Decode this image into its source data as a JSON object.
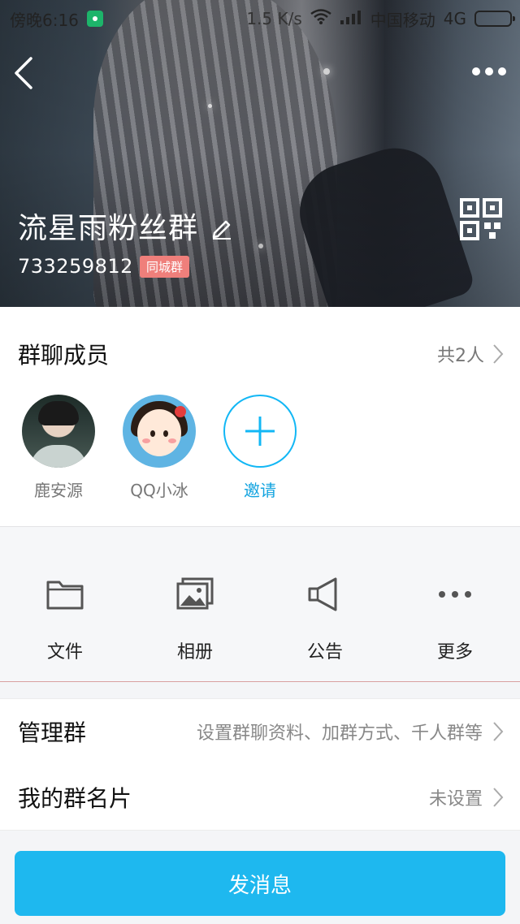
{
  "status_bar": {
    "time": "傍晚6:16",
    "speed": "1.5 K/s",
    "carrier": "中国移动",
    "network": "4G"
  },
  "group": {
    "name": "流星雨粉丝群",
    "id": "733259812",
    "tag": "同城群"
  },
  "members": {
    "title": "群聊成员",
    "count_label": "共2人",
    "list": [
      {
        "name": "鹿安源"
      },
      {
        "name": "QQ小冰"
      }
    ],
    "invite_label": "邀请"
  },
  "quick_actions": [
    {
      "label": "文件",
      "icon": "folder-icon"
    },
    {
      "label": "相册",
      "icon": "album-icon"
    },
    {
      "label": "公告",
      "icon": "megaphone-icon"
    },
    {
      "label": "更多",
      "icon": "more-icon"
    }
  ],
  "settings": {
    "manage": {
      "label": "管理群",
      "value": "设置群聊资料、加群方式、千人群等"
    },
    "card": {
      "label": "我的群名片",
      "value": "未设置"
    }
  },
  "send_button": "发消息",
  "colors": {
    "accent": "#1eb8ef",
    "tag": "#ef7f7b",
    "battery": "#f5a623"
  }
}
